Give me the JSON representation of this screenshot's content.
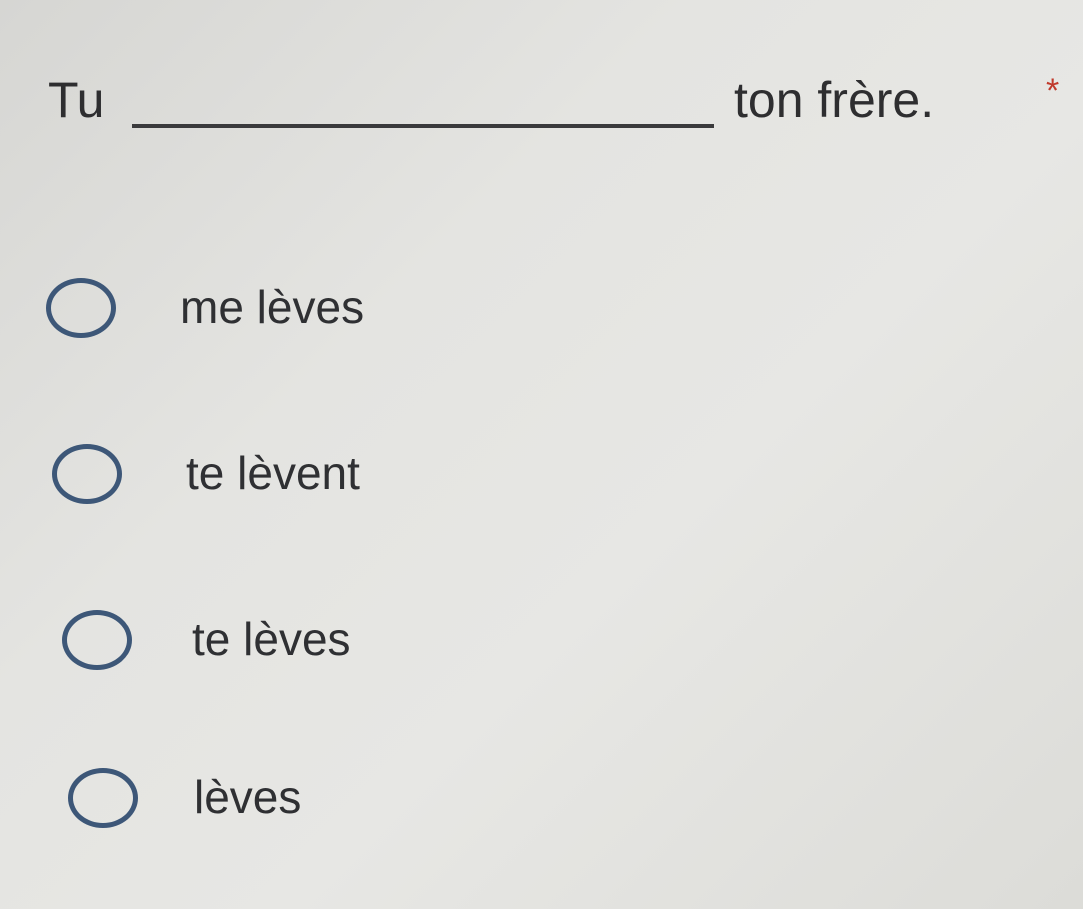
{
  "question": {
    "before_blank": "Tu",
    "after_blank": "ton frère.",
    "required_marker": "*"
  },
  "options": [
    {
      "label": "me lèves",
      "selected": false
    },
    {
      "label": "te lèvent",
      "selected": false
    },
    {
      "label": "te lèves",
      "selected": false
    },
    {
      "label": "lèves",
      "selected": false
    }
  ],
  "colors": {
    "radio_border": "#3d5778",
    "required_marker": "#c0392b",
    "text": "#2e2e30"
  }
}
